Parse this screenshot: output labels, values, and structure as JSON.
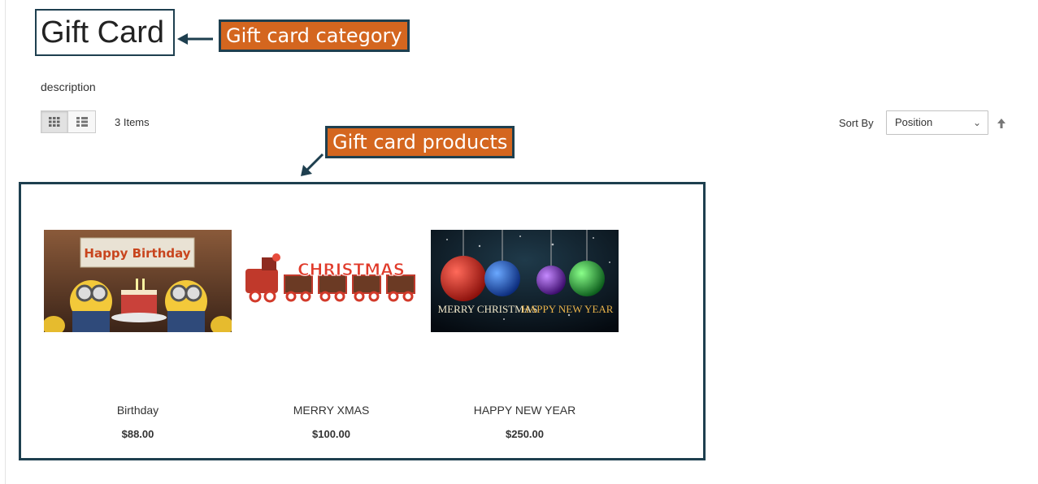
{
  "page": {
    "title": "Gift Card",
    "description": "description"
  },
  "annotations": {
    "category_callout": "Gift card category",
    "products_callout": "Gift card products"
  },
  "toolbar": {
    "view_modes": [
      {
        "name": "grid",
        "icon": "grid-icon",
        "active": true
      },
      {
        "name": "list",
        "icon": "list-icon",
        "active": false
      }
    ],
    "item_count": "3 Items",
    "sort_label": "Sort By",
    "sort_value": "Position",
    "sort_direction_icon": "arrow-up-icon"
  },
  "products": [
    {
      "name": "Birthday",
      "price": "$88.00",
      "image_text": "Happy Birthday"
    },
    {
      "name": "MERRY XMAS",
      "price": "$100.00",
      "image_text": "CHRISTMAS"
    },
    {
      "name": "HAPPY NEW YEAR",
      "price": "$250.00",
      "image_text_1": "MERRY CHRISTMAS",
      "image_text_2": "HAPPY NEW YEAR"
    }
  ],
  "colors": {
    "annotation_bg": "#d4661f",
    "annotation_border": "#1e3f4f"
  }
}
